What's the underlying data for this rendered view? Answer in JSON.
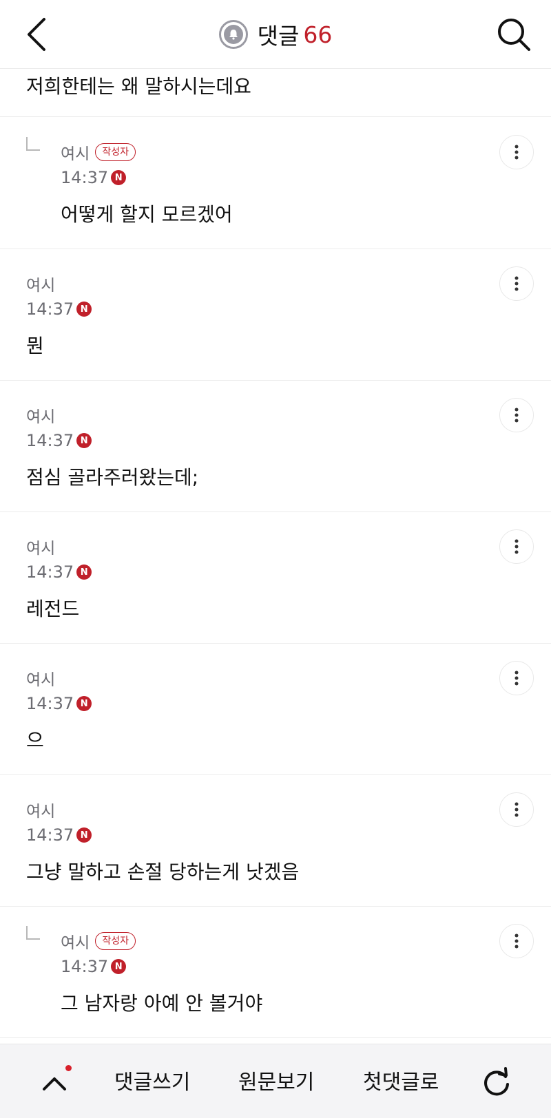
{
  "header": {
    "title": "댓글",
    "count": "66"
  },
  "top_fragment": {
    "text": "저희한테는 왜 말하시는데요"
  },
  "comments": [
    {
      "author": "여시",
      "badge": "작성자",
      "time": "14:37",
      "new_badge": "N",
      "text": "어떻게 할지 모르겠어",
      "is_reply": true
    },
    {
      "author": "여시",
      "badge": "",
      "time": "14:37",
      "new_badge": "N",
      "text": "뭔",
      "is_reply": false
    },
    {
      "author": "여시",
      "badge": "",
      "time": "14:37",
      "new_badge": "N",
      "text": "점심 골라주러왔는데;",
      "is_reply": false
    },
    {
      "author": "여시",
      "badge": "",
      "time": "14:37",
      "new_badge": "N",
      "text": "레전드",
      "is_reply": false
    },
    {
      "author": "여시",
      "badge": "",
      "time": "14:37",
      "new_badge": "N",
      "text": "으",
      "is_reply": false
    },
    {
      "author": "여시",
      "badge": "",
      "time": "14:37",
      "new_badge": "N",
      "text": "그냥 말하고 손절 당하는게 낫겠음",
      "is_reply": false
    },
    {
      "author": "여시",
      "badge": "작성자",
      "time": "14:37",
      "new_badge": "N",
      "text": "그 남자랑 아예 안 볼거야",
      "is_reply": true
    }
  ],
  "bottom_bar": {
    "write_comment": "댓글쓰기",
    "view_original": "원문보기",
    "first_comment": "첫댓글로"
  },
  "colors": {
    "accent": "#c0202a",
    "meta_text": "#6c6c72",
    "divider": "#ececec",
    "bottom_bar_bg": "#f4f4f6"
  }
}
